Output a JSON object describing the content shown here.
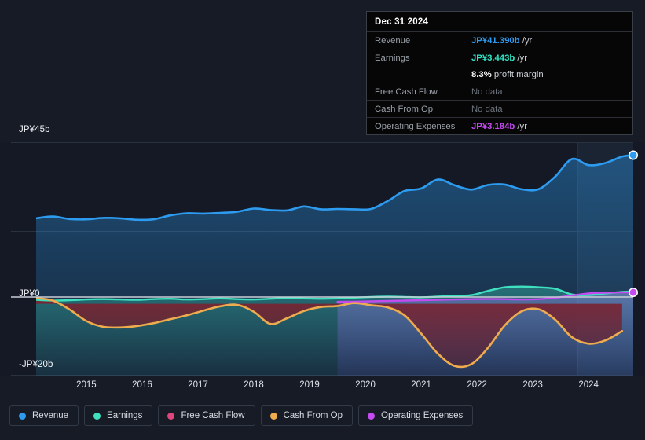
{
  "tooltip": {
    "date": "Dec 31 2024",
    "rows": [
      {
        "key": "Revenue",
        "value": "JP¥41.390b",
        "unit": "/yr",
        "color": "#2d9cf0",
        "nodata": false
      },
      {
        "key": "Earnings",
        "value": "JP¥3.443b",
        "unit": "/yr",
        "color": "#2ee6c5",
        "nodata": false
      },
      {
        "key": "",
        "value": "8.3%",
        "unit": "profit margin",
        "color": "#ffffff",
        "nodata": false
      },
      {
        "key": "Free Cash Flow",
        "value": "No data",
        "unit": "",
        "color": "#6e747c",
        "nodata": true
      },
      {
        "key": "Cash From Op",
        "value": "No data",
        "unit": "",
        "color": "#6e747c",
        "nodata": true
      },
      {
        "key": "Operating Expenses",
        "value": "JP¥3.184b",
        "unit": "/yr",
        "color": "#c44bf0",
        "nodata": false
      }
    ]
  },
  "legend": {
    "items": [
      {
        "label": "Revenue",
        "color": "#2d9cf0"
      },
      {
        "label": "Earnings",
        "color": "#3fe0bf"
      },
      {
        "label": "Free Cash Flow",
        "color": "#e0457b"
      },
      {
        "label": "Cash From Op",
        "color": "#efac4e"
      },
      {
        "label": "Operating Expenses",
        "color": "#c44bf0"
      }
    ]
  },
  "axes": {
    "y_top_label": "JP¥45b",
    "y_zero_label": "JP¥0",
    "y_bottom_label": "-JP¥20b",
    "x_ticks": [
      "2015",
      "2016",
      "2017",
      "2018",
      "2019",
      "2020",
      "2021",
      "2022",
      "2023",
      "2024"
    ]
  },
  "chart_data": {
    "type": "area",
    "title": "",
    "xlabel": "",
    "ylabel": "JP¥ (billions)",
    "ylim": [
      -20,
      45
    ],
    "xlim": [
      2014.6,
      2025.3
    ],
    "grid": true,
    "legend_position": "bottom",
    "currency": "JP¥",
    "units": "billions per year",
    "forecast_start": 2024.3,
    "x": [
      2014.6,
      2014.9,
      2015.2,
      2015.5,
      2015.8,
      2016.1,
      2016.4,
      2016.7,
      2017.0,
      2017.3,
      2017.6,
      2017.9,
      2018.2,
      2018.5,
      2018.8,
      2019.1,
      2019.4,
      2019.7,
      2020.0,
      2020.3,
      2020.6,
      2020.9,
      2021.2,
      2021.5,
      2021.8,
      2022.1,
      2022.4,
      2022.7,
      2023.0,
      2023.3,
      2023.6,
      2023.9,
      2024.2,
      2024.5,
      2024.8,
      2025.1,
      2025.3
    ],
    "series": [
      {
        "name": "Revenue",
        "color": "#2d9cf0",
        "fill": true,
        "end_marker": true,
        "end_value": 41.39,
        "values": [
          23.8,
          24.3,
          23.6,
          23.5,
          23.9,
          23.8,
          23.4,
          23.5,
          24.6,
          25.2,
          25.1,
          25.3,
          25.6,
          26.5,
          26.1,
          26.0,
          27.1,
          26.3,
          26.4,
          26.3,
          26.4,
          28.6,
          31.4,
          32.1,
          34.6,
          33.0,
          31.8,
          33.1,
          33.2,
          31.9,
          31.9,
          35.4,
          40.3,
          38.6,
          39.2,
          41.0,
          41.39
        ]
      },
      {
        "name": "Earnings",
        "color": "#3fe0bf",
        "fill": true,
        "end_marker": false,
        "end_value": 3.443,
        "values": [
          1.1,
          0.9,
          1.0,
          1.2,
          1.3,
          1.2,
          1.1,
          1.3,
          1.4,
          1.2,
          1.3,
          1.5,
          1.3,
          1.2,
          1.4,
          1.6,
          1.5,
          1.4,
          1.5,
          1.7,
          1.9,
          2.0,
          1.9,
          1.8,
          2.0,
          2.2,
          2.4,
          3.6,
          4.6,
          4.8,
          4.6,
          4.2,
          2.6,
          2.4,
          2.9,
          3.3,
          3.443
        ]
      },
      {
        "name": "Free Cash Flow",
        "color": "#e0457b",
        "fill": false,
        "end_marker": false,
        "end_value": null,
        "values": [
          null,
          null,
          null,
          null,
          null,
          null,
          null,
          null,
          null,
          null,
          null,
          null,
          null,
          null,
          null,
          null,
          null,
          null,
          null,
          null,
          null,
          null,
          null,
          null,
          null,
          null,
          null,
          null,
          null,
          null,
          null,
          null,
          null,
          null,
          null,
          null,
          null
        ]
      },
      {
        "name": "Cash From Op",
        "color": "#efac4e",
        "fill": true,
        "end_marker": false,
        "end_value": null,
        "values": [
          1.6,
          0.9,
          -1.6,
          -4.8,
          -6.4,
          -6.6,
          -6.2,
          -5.4,
          -4.3,
          -3.2,
          -1.9,
          -0.7,
          -0.3,
          -2.2,
          -5.6,
          -4.0,
          -2.0,
          -0.9,
          -0.6,
          0.2,
          -0.4,
          -1.0,
          -3.2,
          -8.3,
          -13.9,
          -17.3,
          -16.8,
          -12.2,
          -6.0,
          -2.1,
          -1.5,
          -4.4,
          -9.3,
          -11.1,
          -10.2,
          -7.6,
          null
        ]
      },
      {
        "name": "Operating Expenses",
        "color": "#c44bf0",
        "fill": true,
        "end_marker": true,
        "end_value": 3.184,
        "values": [
          null,
          null,
          null,
          null,
          null,
          null,
          null,
          null,
          null,
          null,
          null,
          null,
          null,
          null,
          null,
          null,
          null,
          null,
          0.55,
          0.6,
          0.7,
          0.8,
          0.9,
          1.0,
          1.1,
          1.2,
          1.3,
          1.35,
          1.3,
          1.2,
          1.3,
          1.7,
          2.3,
          2.9,
          3.1,
          3.18,
          3.184
        ]
      }
    ]
  }
}
